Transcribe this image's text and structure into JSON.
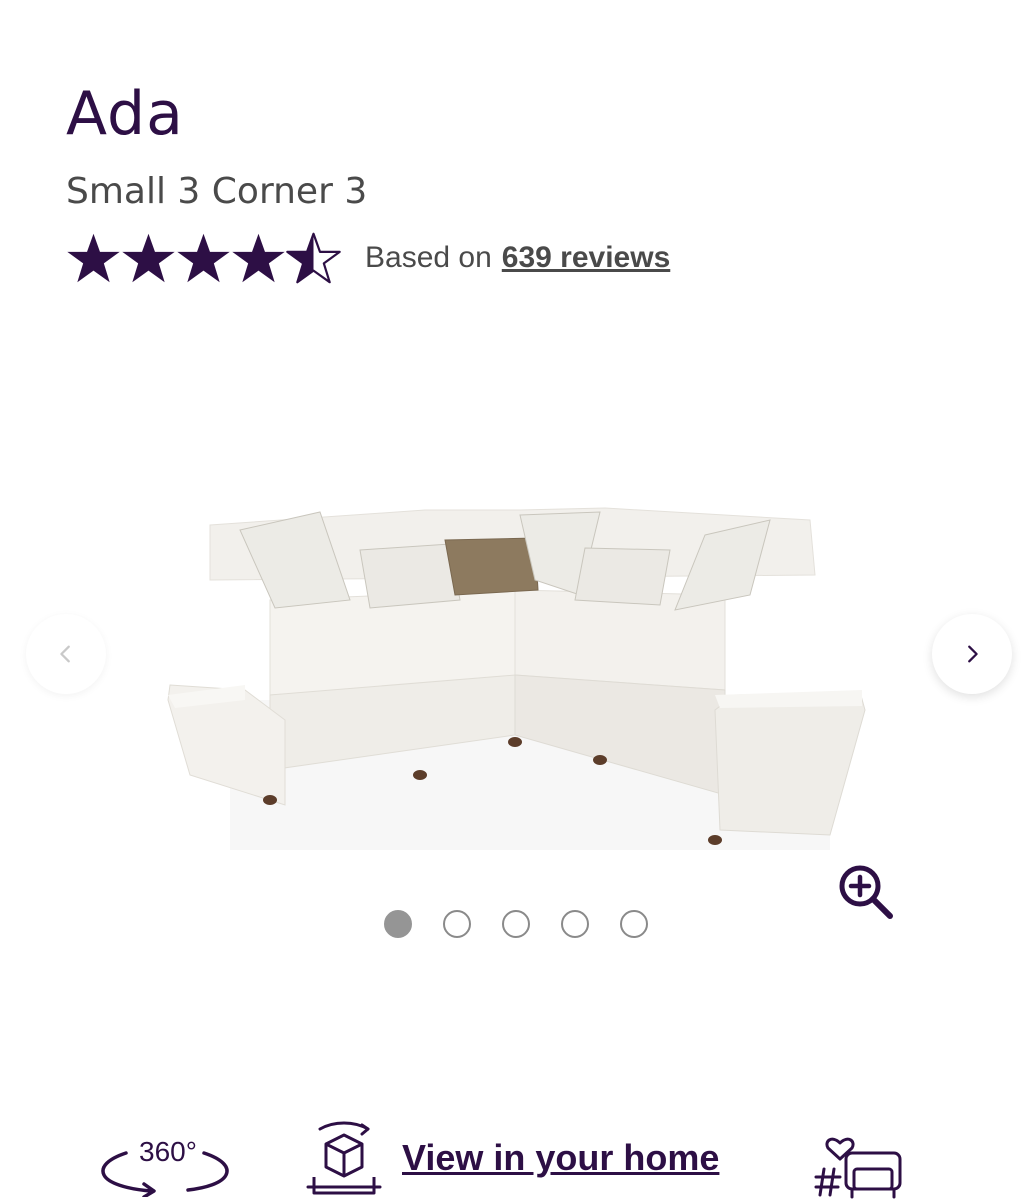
{
  "product": {
    "name": "Ada",
    "variant": "Small 3 Corner 3"
  },
  "rating": {
    "value": 4.5,
    "max": 5,
    "based_on_label": "Based on",
    "reviews_link": "639 reviews"
  },
  "gallery": {
    "image_icon": "corner-sofa-image",
    "current_index": 1,
    "total_images": 5,
    "prev_icon": "chevron-left-icon",
    "next_icon": "chevron-right-icon",
    "zoom_icon": "zoom-in-icon"
  },
  "actions": {
    "view_360_label": "360°",
    "view_in_home_label": "View in your home",
    "share_icon": "hashtag-sofa-heart-icon"
  },
  "colors": {
    "brand": "#2d0f45",
    "text_muted": "#4a4a4a",
    "dot_active": "#959595"
  }
}
